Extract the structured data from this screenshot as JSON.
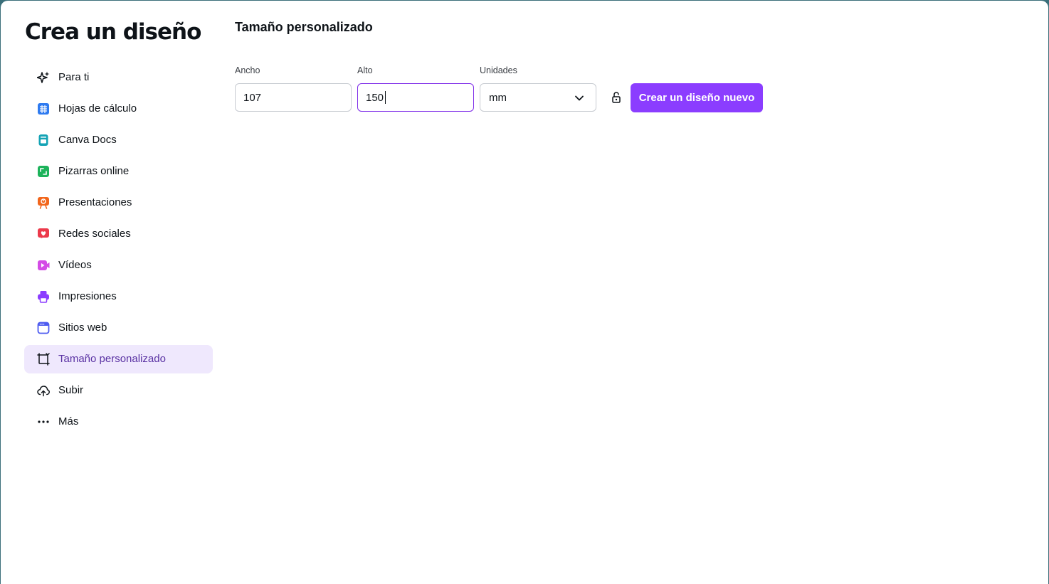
{
  "app": {
    "title": "Crea un diseño"
  },
  "sidebar": {
    "items": [
      {
        "label": "Para ti",
        "icon": "sparkle-icon",
        "color": "#0e1318"
      },
      {
        "label": "Hojas de cálculo",
        "icon": "spreadsheet-icon",
        "color": "#2f7bf0"
      },
      {
        "label": "Canva Docs",
        "icon": "doc-icon",
        "color": "#13a3b5"
      },
      {
        "label": "Pizarras online",
        "icon": "whiteboard-icon",
        "color": "#1db35b"
      },
      {
        "label": "Presentaciones",
        "icon": "presentation-icon",
        "color": "#f2661c"
      },
      {
        "label": "Redes sociales",
        "icon": "heart-icon",
        "color": "#ec3a4b"
      },
      {
        "label": "Vídeos",
        "icon": "video-icon",
        "color": "#d44ce6"
      },
      {
        "label": "Impresiones",
        "icon": "printer-icon",
        "color": "#8b3dff"
      },
      {
        "label": "Sitios web",
        "icon": "website-icon",
        "color": "#4d5bf0"
      },
      {
        "label": "Tamaño personalizado",
        "icon": "custom-size-icon",
        "color": "#0e1318",
        "active": true
      },
      {
        "label": "Subir",
        "icon": "cloud-upload-icon",
        "color": "#0e1318"
      },
      {
        "label": "Más",
        "icon": "more-icon",
        "color": "#0e1318"
      }
    ]
  },
  "custom_size": {
    "title": "Tamaño personalizado",
    "width_label": "Ancho",
    "width_value": "107",
    "height_label": "Alto",
    "height_value": "150",
    "units_label": "Unidades",
    "units_value": "mm",
    "create_button": "Crear un diseño nuevo"
  },
  "colors": {
    "accent": "#8b3dff",
    "focus_border": "#7d2ae8",
    "active_nav_bg": "#efe8fd"
  }
}
